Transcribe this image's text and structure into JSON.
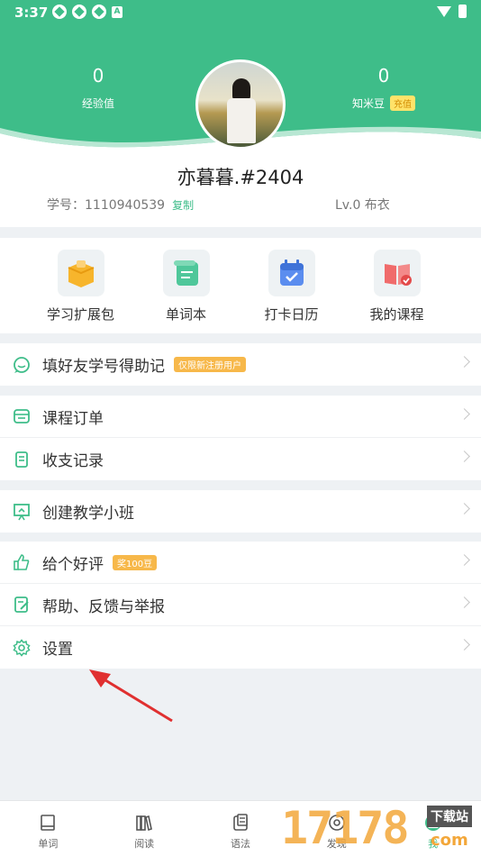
{
  "status": {
    "time": "3:37"
  },
  "header": {
    "exp": {
      "value": "0",
      "label": "经验值"
    },
    "beans": {
      "value": "0",
      "label": "知米豆",
      "badge": "充值"
    }
  },
  "profile": {
    "name": "亦暮暮.#2404",
    "student_id_label": "学号：",
    "student_id": "1110940539",
    "copy": "复制",
    "level": "Lv.0 布衣"
  },
  "quick": [
    {
      "label": "学习扩展包",
      "icon": "package-icon"
    },
    {
      "label": "单词本",
      "icon": "scroll-icon"
    },
    {
      "label": "打卡日历",
      "icon": "calendar-icon"
    },
    {
      "label": "我的课程",
      "icon": "book-icon"
    }
  ],
  "menu": {
    "invite": {
      "label": "填好友学号得助记",
      "tag": "仅限新注册用户"
    },
    "orders": {
      "label": "课程订单"
    },
    "records": {
      "label": "收支记录"
    },
    "class": {
      "label": "创建教学小班"
    },
    "review": {
      "label": "给个好评",
      "tag": "奖100豆"
    },
    "help": {
      "label": "帮助、反馈与举报"
    },
    "settings": {
      "label": "设置"
    }
  },
  "tabs": [
    {
      "label": "单词"
    },
    {
      "label": "阅读"
    },
    {
      "label": "语法"
    },
    {
      "label": "发现"
    },
    {
      "label": "我"
    }
  ],
  "watermark": {
    "digits": "17178",
    "badge": "下载站",
    "domain": "com"
  },
  "colors": {
    "brand": "#3ebd89",
    "accent_orange": "#f7b84a",
    "arrow": "#e03030"
  }
}
